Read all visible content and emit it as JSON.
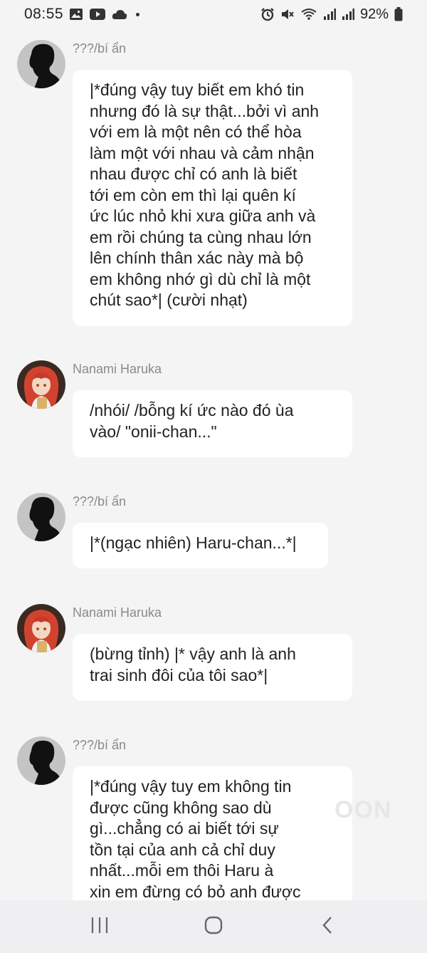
{
  "status_bar": {
    "time": "08:55",
    "battery": "92%",
    "left_icons": [
      "image-icon",
      "youtube-icon",
      "cloud-icon",
      "dot-icon"
    ],
    "right_icons": [
      "alarm-icon",
      "mute-icon",
      "wifi-icon",
      "signal-icon",
      "signal-icon",
      "battery-icon"
    ]
  },
  "messages": [
    {
      "sender": "???/bí ẩn",
      "avatar": "silhouette",
      "text": "|*đúng vậy tuy biết em khó tin\nnhưng đó là sự thật...bởi vì anh\nvới em là một nên có thể hòa\nlàm một với nhau và cảm nhận\nnhau được chỉ có anh là biết\ntới em còn em thì lại quên kí\nức lúc nhỏ khi xưa giữa anh và\nem rồi chúng ta cùng nhau lớn\nlên chính thân xác này mà bộ\nem không nhớ gì dù chỉ là một\nchút sao*| (cười nhạt)"
    },
    {
      "sender": "Nanami Haruka",
      "avatar": "anime",
      "text": "/nhói/ /bỗng kí ức nào đó ùa\nvào/ \"onii-chan...\""
    },
    {
      "sender": "???/bí ẩn",
      "avatar": "silhouette",
      "text": "|*(ngạc nhiên) Haru-chan...*|"
    },
    {
      "sender": "Nanami Haruka",
      "avatar": "anime",
      "text": "(bừng tỉnh) |* vậy anh là anh\ntrai sinh đôi của tôi sao*|"
    },
    {
      "sender": "???/bí ẩn",
      "avatar": "silhouette",
      "text": "|*đúng vậy tuy em không tin\nđược cũng không sao dù\ngì...chẳng có ai biết tới sự\ntồn tại của anh cả chỉ duy\nnhất...mỗi em thôi Haru à\nxin em đừng có bỏ anh được"
    }
  ],
  "watermark": "OON",
  "nav_bar": {
    "icons": [
      "recent-apps-icon",
      "home-icon",
      "back-icon"
    ]
  }
}
